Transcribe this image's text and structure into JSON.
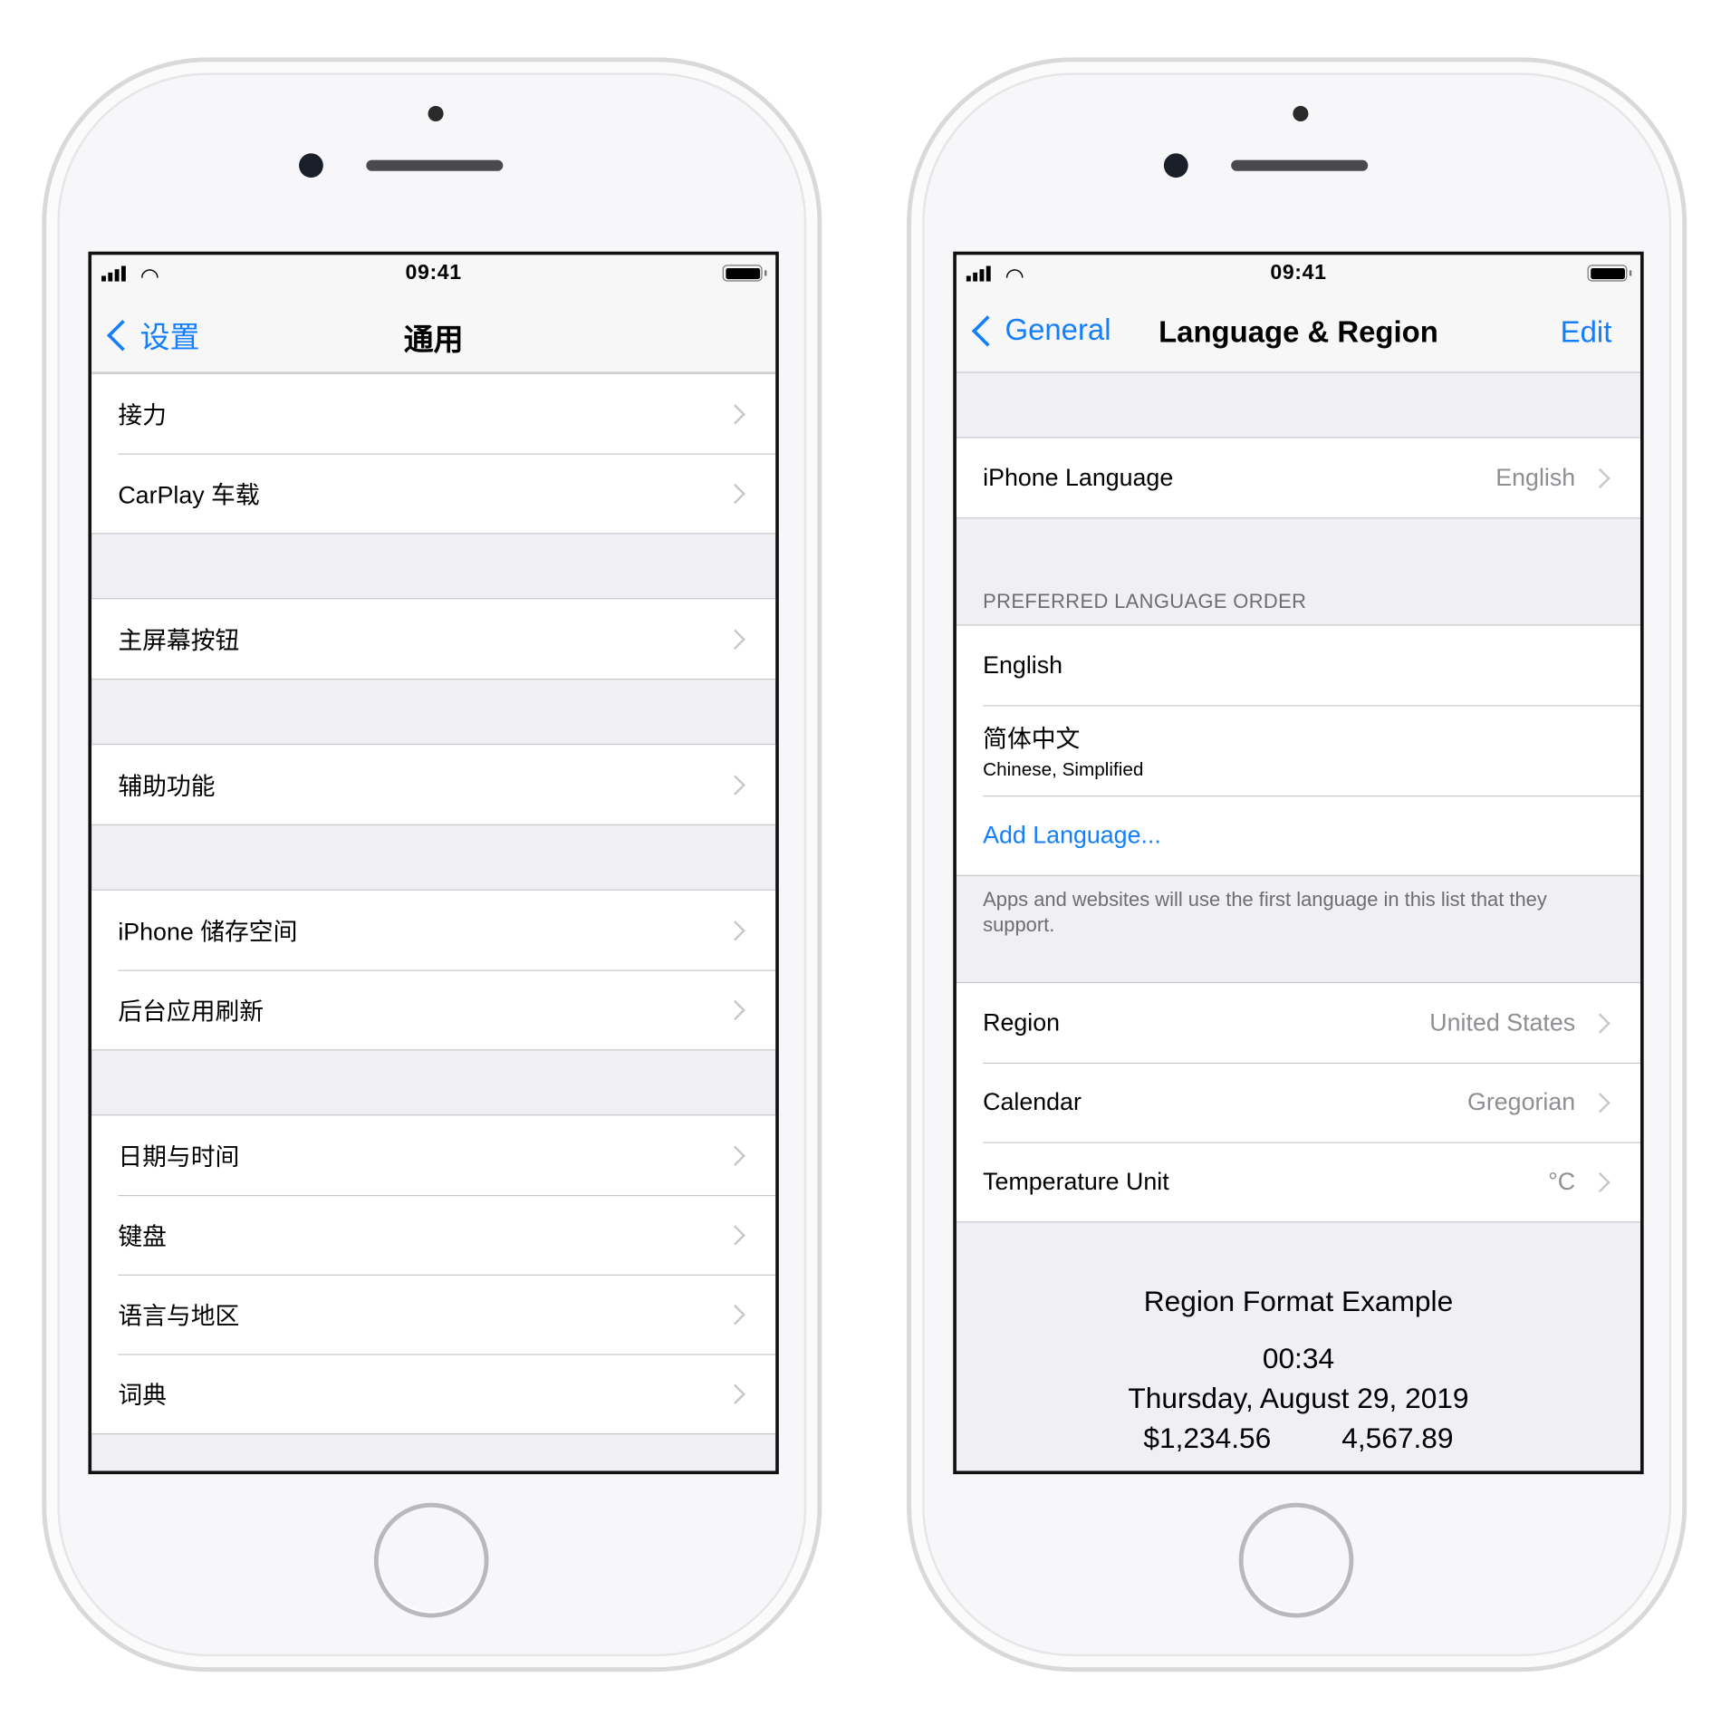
{
  "status_bar": {
    "time": "09:41"
  },
  "left": {
    "nav": {
      "back": "设置",
      "title": "通用"
    },
    "groups": [
      [
        "接力",
        "CarPlay 车载"
      ],
      [
        "主屏幕按钮"
      ],
      [
        "辅助功能"
      ],
      [
        "iPhone 储存空间",
        "后台应用刷新"
      ],
      [
        "日期与时间",
        "键盘",
        "语言与地区",
        "词典"
      ]
    ]
  },
  "right": {
    "nav": {
      "back": "General",
      "title": "Language & Region",
      "edit": "Edit"
    },
    "iphone_language": {
      "label": "iPhone Language",
      "value": "English"
    },
    "preferred_header": "PREFERRED LANGUAGE ORDER",
    "languages": [
      {
        "name": "English"
      },
      {
        "name": "简体中文",
        "sub": "Chinese, Simplified"
      }
    ],
    "add_language": "Add Language...",
    "footer": "Apps and websites will use the first language in this list that they support.",
    "region": {
      "label": "Region",
      "value": "United States"
    },
    "calendar": {
      "label": "Calendar",
      "value": "Gregorian"
    },
    "temperature": {
      "label": "Temperature Unit",
      "value": "°C"
    },
    "example": {
      "title": "Region Format Example",
      "time": "00:34",
      "date": "Thursday, August 29, 2019",
      "currency": "$1,234.56",
      "number": "4,567.89"
    }
  },
  "colors": {
    "accent": "#147efb",
    "group_bg": "#efeff4",
    "secondary_text": "#8e8e93"
  }
}
